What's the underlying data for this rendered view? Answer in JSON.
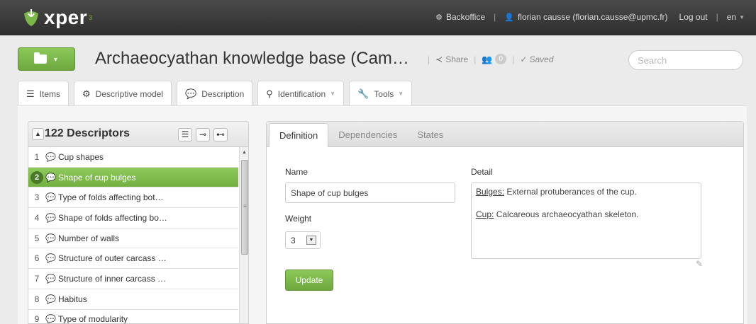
{
  "navbar": {
    "logo_text": "xper",
    "logo_sup": "3",
    "backoffice_label": "Backoffice",
    "user_label": "florian causse (florian.causse@upmc.fr)",
    "logout_label": "Log out",
    "language_label": "en"
  },
  "header": {
    "title": "Archaeocyathan knowledge base (Cam…",
    "share_label": "Share",
    "users_count": "0",
    "saved_label": "Saved",
    "search_placeholder": "Search"
  },
  "tabs": [
    {
      "label": "Items",
      "icon": "list-icon"
    },
    {
      "label": "Descriptive model",
      "icon": "gears-icon"
    },
    {
      "label": "Description",
      "icon": "speech-bubble-icon"
    },
    {
      "label": "Identification",
      "icon": "search-icon"
    },
    {
      "label": "Tools",
      "icon": "wrench-icon"
    }
  ],
  "descriptors": {
    "title": "122 Descriptors",
    "items": [
      {
        "num": "1",
        "label": "Cup shapes"
      },
      {
        "num": "2",
        "label": "Shape of cup bulges"
      },
      {
        "num": "3",
        "label": "Type of folds affecting bot…"
      },
      {
        "num": "4",
        "label": "Shape of folds affecting bo…"
      },
      {
        "num": "5",
        "label": "Number of walls"
      },
      {
        "num": "6",
        "label": "Structure of outer carcass …"
      },
      {
        "num": "7",
        "label": "Structure of inner carcass …"
      },
      {
        "num": "8",
        "label": "Habitus"
      },
      {
        "num": "9",
        "label": "Type of modularity"
      }
    ],
    "selected_index": 1
  },
  "definition": {
    "tabs": [
      "Definition",
      "Dependencies",
      "States"
    ],
    "active_tab": "Definition",
    "name_label": "Name",
    "name_value": "Shape of cup bulges",
    "weight_label": "Weight",
    "weight_value": "3",
    "detail_label": "Detail",
    "detail_term1": "Bulges:",
    "detail_text1": " External protuberances of the cup.",
    "detail_term2": "Cup:",
    "detail_text2": " Calcareous archaeocyathan skeleton.",
    "update_label": "Update"
  },
  "colors": {
    "accent_green": "#7ab648",
    "navbar_dark": "#333333"
  }
}
